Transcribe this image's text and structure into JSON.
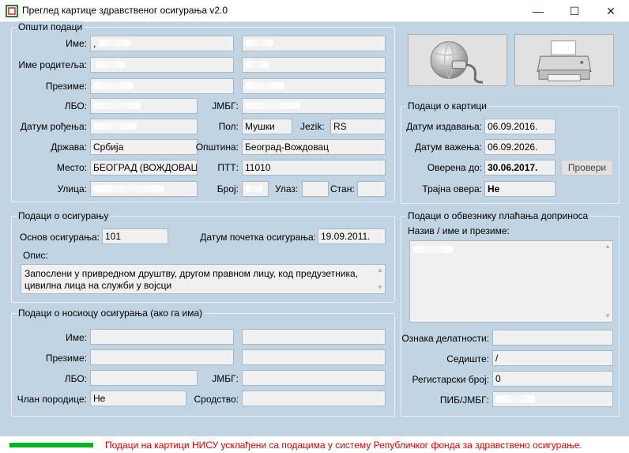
{
  "window": {
    "title": "Преглед картице здравственог осигурања v2.0",
    "min_glyph": "—",
    "max_glyph": "☐",
    "close_glyph": "✕"
  },
  "opsti": {
    "title": "Општи подаци",
    "ime_label": "Име:",
    "ime_value": ",",
    "roditelj_label": "Име родитеља:",
    "prezime_label": "Презиме:",
    "lbo_label": "ЛБО:",
    "jmbg_label": "ЈМБГ:",
    "datum_rodjenja_label": "Датум рођења:",
    "pol_label": "Пол:",
    "pol_value": "Мушки",
    "jezik_label": "Jezik:",
    "jezik_value": "RS",
    "drzava_label": "Држава:",
    "drzava_value": "Србија",
    "opstina_label": "Општина:",
    "opstina_value": "Београд-Вождовац",
    "mesto_label": "Место:",
    "mesto_value": "БЕОГРАД (ВОЖДОВАЦ)",
    "ptt_label": "ПТТ:",
    "ptt_value": "11010",
    "ulica_label": "Улица:",
    "broj_label": "Број:",
    "ulaz_label": "Улаз:",
    "stan_label": "Стан:"
  },
  "kartica": {
    "title": "Подаци о картици",
    "datum_izdavanja_label": "Датум издавања:",
    "datum_izdavanja_value": "06.09.2016.",
    "datum_vazenja_label": "Датум важења:",
    "datum_vazenja_value": "06.09.2026.",
    "overena_label": "Оверена до:",
    "overena_value": "30.06.2017.",
    "proveri_label": "Провери",
    "trajna_label": "Трајна овера:",
    "trajna_value": "Не"
  },
  "osiguranje": {
    "title": "Подаци о осигурању",
    "osnov_label": "Основ осигурања:",
    "osnov_value": "101",
    "datum_pocetka_label": "Датум почетка осигурања:",
    "datum_pocetka_value": "19.09.2011.",
    "opis_label": "Опис:",
    "opis_value": "Запослени у привредном друштву, другом правном лицу, код предузетника, цивилна лица на служби у војсци"
  },
  "nosilac": {
    "title": "Подаци о носиоцу осигурања (ако га има)",
    "ime_label": "Име:",
    "prezime_label": "Презиме:",
    "lbo_label": "ЛБО:",
    "jmbg_label": "ЈМБГ:",
    "clan_label": "Члан породице:",
    "clan_value": "Не",
    "srodstvo_label": "Сродство:"
  },
  "obveznik": {
    "title": "Подаци о обвезнику плаћања доприноса",
    "naziv_label": "Назив / име и презиме:",
    "delatnost_label": "Ознака делатности:",
    "sediste_label": "Седиште:",
    "sediste_value": "/",
    "registarski_label": "Регистарски број:",
    "registarski_value": "0",
    "pib_label": "ПИБ/ЈМБГ:"
  },
  "status": {
    "progress": 1.0,
    "progress_color": "#06b025",
    "message": "Подаци на картици НИСУ усклађени са подацима у систему Републичког фонда за здравствено осигурање.",
    "message_color": "#e00000"
  },
  "icons": {
    "read_button": "globe-connector-icon",
    "print_button": "printer-icon"
  }
}
